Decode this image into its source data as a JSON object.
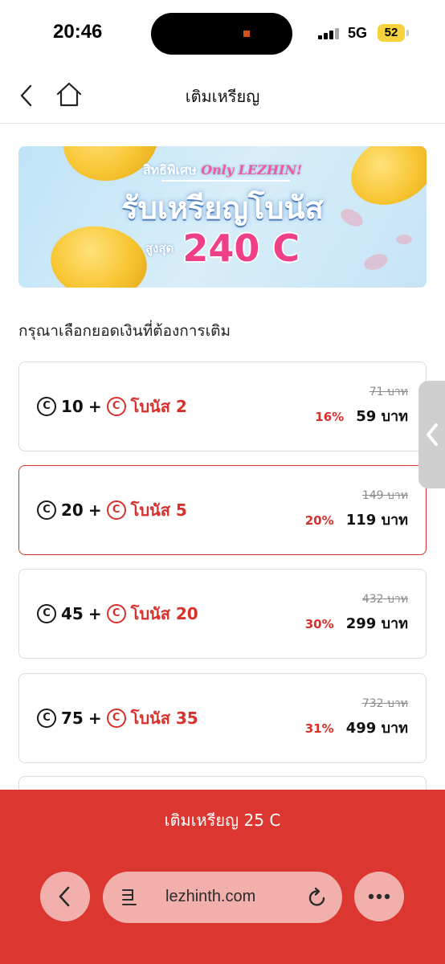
{
  "status_bar": {
    "time": "20:46",
    "network": "5G",
    "battery": "52"
  },
  "header": {
    "title": "เติมเหรียญ"
  },
  "banner": {
    "prefix": "สิทธิพิเศษ",
    "prefix_highlight": "Only LEZHIN!",
    "headline": "รับเหรียญโบนัส",
    "max_label": "สูงสุด",
    "amount": "240 C"
  },
  "section_title": "กรุณาเลือกยอดเงินที่ต้องการเติม",
  "packages": [
    {
      "coins": "10",
      "plus": "+",
      "bonus": "โบนัส 2",
      "old_price": "71 บาท",
      "discount": "16%",
      "price": "59 บาท",
      "selected": false
    },
    {
      "coins": "20",
      "plus": "+",
      "bonus": "โบนัส 5",
      "old_price": "149 บาท",
      "discount": "20%",
      "price": "119 บาท",
      "selected": true
    },
    {
      "coins": "45",
      "plus": "+",
      "bonus": "โบนัส 20",
      "old_price": "432 บาท",
      "discount": "30%",
      "price": "299 บาท",
      "selected": false
    },
    {
      "coins": "75",
      "plus": "+",
      "bonus": "โบนัส 35",
      "old_price": "732 บาท",
      "discount": "31%",
      "price": "499 บาท",
      "selected": false
    }
  ],
  "coin_symbol": "C",
  "topup_button": "เติมเหรียญ 25 C",
  "browser": {
    "url": "lezhinth.com"
  },
  "colors": {
    "accent": "#db3630",
    "price_red": "#d9302b",
    "banner_pink": "#ee3f87"
  },
  "icons": [
    "back-icon",
    "home-icon",
    "chevron-left-icon",
    "reader-icon",
    "reload-icon",
    "more-icon"
  ]
}
